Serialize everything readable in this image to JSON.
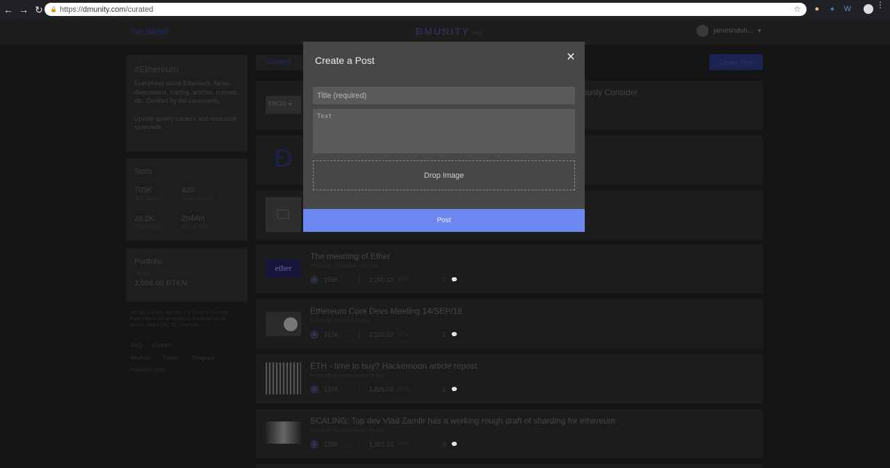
{
  "browser": {
    "url_scheme": "https://",
    "url_host": "dmunity.com",
    "url_path": "/curated"
  },
  "header": {
    "get_started": "Get started",
    "logo": "ĐMUNITY",
    "logo_beta": "Beta",
    "username": "jamesndun..."
  },
  "about": {
    "title": "#Ethereum",
    "description": "Everything about Ethereum. News, discussions, trading, articles, memes, etc. Curated by the community.",
    "note": "Upvote quality content and downvote spam/ads."
  },
  "stats": {
    "title": "Stats",
    "items": [
      {
        "value": "705K",
        "label": "Total Supply"
      },
      {
        "value": "420",
        "label": "Token Holders"
      },
      {
        "value": "28.2K",
        "label": "Next Payout"
      },
      {
        "value": "2h44m",
        "label": "Payout Time"
      }
    ]
  },
  "portfolio": {
    "title": "Portfolio",
    "tokens_label": "Tokens",
    "tokens_value": "2,056.00 ĐTKN"
  },
  "left_note": "We are in Beta, and this is a Proof of Concept. Beta tokens will be ported to the Main net on launch. Read FAQ for more info.",
  "footer": {
    "faq": "FAQ",
    "contact": "Contact",
    "medium": "Medium",
    "twitter": "Twitter",
    "telegram": "Telegram",
    "copyright": "© ĐMUNITY 2018"
  },
  "tabs": {
    "curated": "Curated"
  },
  "create_post_button": "Create Post",
  "posts": [
    {
      "title": "ously Consider",
      "thumb": "ERC20",
      "meta": "",
      "votes": "",
      "amount": "",
      "unit": "",
      "comments": ""
    },
    {
      "title": "",
      "thumb": "Đ",
      "meta": "",
      "votes": "",
      "amount": "",
      "unit": "",
      "comments": ""
    },
    {
      "title": "",
      "thumb": "",
      "meta": "",
      "votes": "",
      "amount": "",
      "unit": "",
      "comments": ""
    },
    {
      "title": "The meaning of Ether",
      "thumb": "ether",
      "meta": "Posted by Smargaldis • 16h ago",
      "votes": "159K",
      "amount": "2,260.12",
      "unit": "ĐTKN",
      "comments": "1"
    },
    {
      "title": "Ethereum Core Devs Meeting 14/SEP/18",
      "thumb": "",
      "meta": "Posted by foozhay • 2h ago",
      "votes": "157K",
      "amount": "2,102.52",
      "unit": "ĐTKN",
      "comments": "1"
    },
    {
      "title": "ETH - time to buy? Hackernoon article repost",
      "thumb": "",
      "meta": "Posted by EustaceBaggs • 1h ago",
      "votes": "137K",
      "amount": "1,826.03",
      "unit": "ĐTKN",
      "comments": "1"
    },
    {
      "title": "SCALING: Top dev Vlad Zamfir has a working rough draft of sharding for ethereum",
      "thumb": "",
      "meta": "Posted by fluxmechanical • 1h ago",
      "votes": "135K",
      "amount": "1,801.23",
      "unit": "ĐTKN",
      "comments": "0"
    }
  ],
  "modal": {
    "title": "Create a Post",
    "title_placeholder": "Title (required)",
    "text_placeholder": "Text",
    "drop_image": "Drop Image",
    "post_button": "Post"
  },
  "colors": {
    "accent": "#6c87f0",
    "modal_bg": "#474747",
    "page_bg": "#151515"
  }
}
